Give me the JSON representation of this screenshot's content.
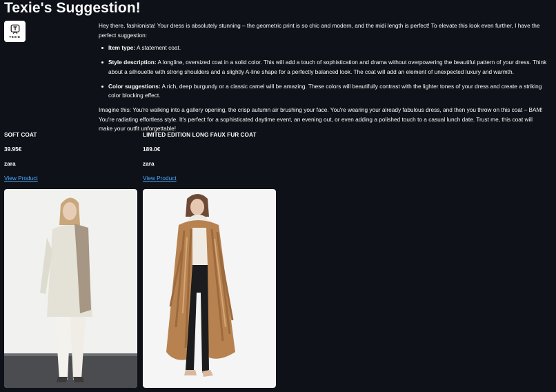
{
  "page": {
    "title": "Texie's Suggestion!",
    "avatar_label": "TEXIE"
  },
  "message": {
    "intro": "Hey there, fashionista! Your dress is absolutely stunning – the geometric print is so chic and modern, and the midi length is perfect! To elevate this look even further, I have the perfect suggestion:",
    "bullets": [
      {
        "label": "Item type:",
        "text": " A statement coat."
      },
      {
        "label": "Style description:",
        "text": " A longline, oversized coat in a solid color. This will add a touch of sophistication and drama without overpowering the beautiful pattern of your dress. Think about a silhouette with strong shoulders and a slightly A-line shape for a perfectly balanced look. The coat will add an element of unexpected luxury and warmth."
      },
      {
        "label": "Color suggestions:",
        "text": " A rich, deep burgundy or a classic camel will be amazing. These colors will beautifully contrast with the lighter tones of your dress and create a striking color blocking effect."
      }
    ],
    "outro": "Imagine this: You're walking into a gallery opening, the crisp autumn air brushing your face. You're wearing your already fabulous dress, and then you throw on this coat – BAM! You're radiating effortless style. It's perfect for a sophisticated daytime event, an evening out, or even adding a polished touch to a casual lunch date. Trust me, this coat will make your outfit unforgettable!"
  },
  "products": [
    {
      "name": "SOFT COAT",
      "price": "39.95€",
      "brand": "zara",
      "link_label": "View Product"
    },
    {
      "name": "LIMITED EDITION LONG FAUX FUR COAT",
      "price": "189.0€",
      "brand": "zara",
      "link_label": "View Product"
    }
  ],
  "colors": {
    "background": "#0e1117",
    "text": "#fafafa",
    "link": "#4aa8ff"
  }
}
